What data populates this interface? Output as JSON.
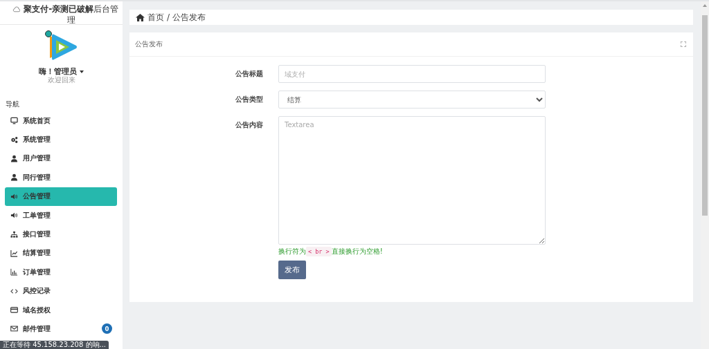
{
  "sidebar": {
    "title": "**聚支付-亲测已破解**后台管理",
    "user": {
      "name": "嗨！管理员",
      "online": true,
      "subtitle": "欢迎回来"
    },
    "section": "导航",
    "items": [
      {
        "label": "系统首页",
        "selected": false
      },
      {
        "label": "系统管理",
        "selected": false
      },
      {
        "label": "用户管理",
        "selected": false
      },
      {
        "label": "同行管理",
        "selected": false
      },
      {
        "label": "公告管理",
        "selected": true
      },
      {
        "label": "工单管理",
        "selected": false
      },
      {
        "label": "接口管理",
        "selected": false
      },
      {
        "label": "结算管理",
        "selected": false
      },
      {
        "label": "订单管理",
        "selected": false
      },
      {
        "label": "风控记录",
        "selected": false
      },
      {
        "label": "域名授权",
        "selected": false
      },
      {
        "label": "邮件管理",
        "selected": false,
        "badge": "0"
      }
    ]
  },
  "breadcrumb": [
    "首页",
    "/",
    "公告发布"
  ],
  "card": {
    "title": "公告发布",
    "fields": [
      {
        "kind": "input",
        "label": "公告标题",
        "placeholder": "域支付"
      },
      {
        "kind": "select",
        "label": "公告类型",
        "value": "结算"
      },
      {
        "kind": "textarea",
        "label": "公告内容",
        "placeholder": "Textarea"
      }
    ],
    "hint": {
      "before": "换行符为",
      "code": "< br >",
      "after": "直接换行为空格!"
    },
    "submit": "发布"
  },
  "status_bar": "正在等待 45.158.23.208 的响..."
}
